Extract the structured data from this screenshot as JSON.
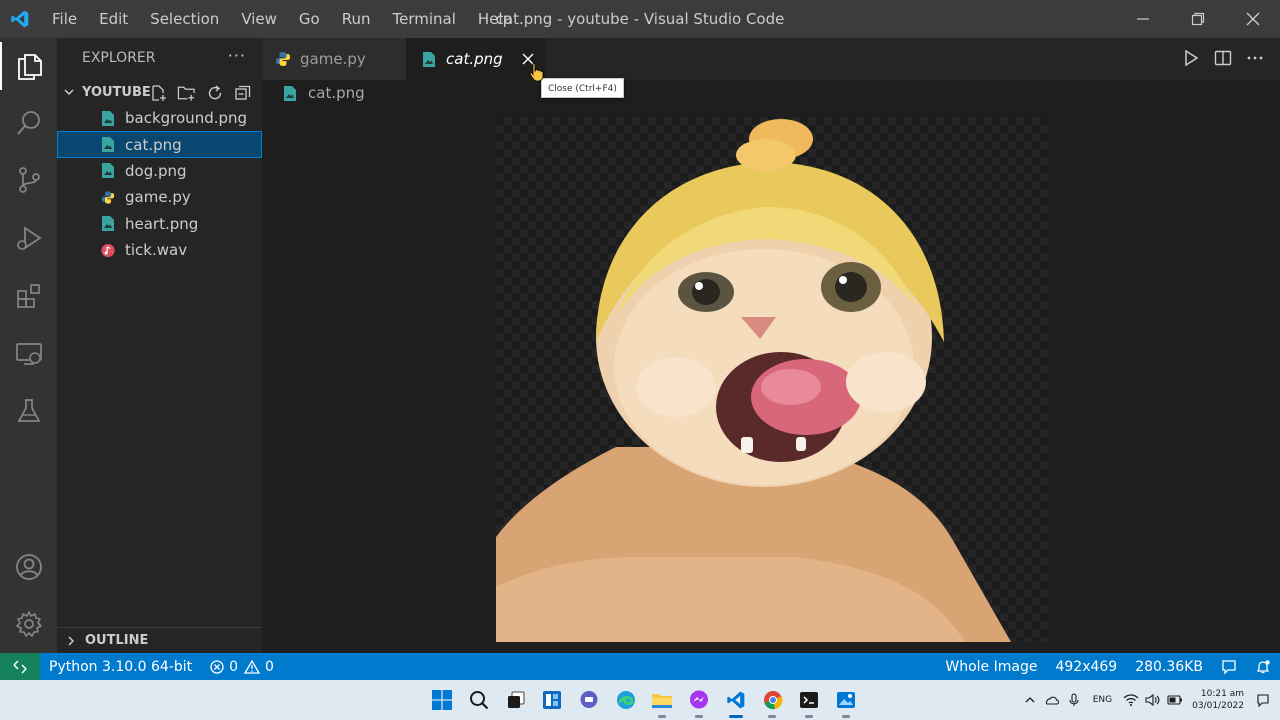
{
  "window": {
    "title": "cat.png - youtube - Visual Studio Code",
    "menu": [
      "File",
      "Edit",
      "Selection",
      "View",
      "Go",
      "Run",
      "Terminal",
      "Help"
    ]
  },
  "activity_bar": {
    "items": [
      "explorer-icon",
      "search-icon",
      "source-control-icon",
      "run-debug-icon",
      "extensions-icon",
      "remote-explorer-icon",
      "testing-icon"
    ],
    "bottom": [
      "accounts-icon",
      "settings-gear-icon"
    ]
  },
  "explorer": {
    "title": "EXPLORER",
    "more": "···",
    "folder": "YOUTUBE",
    "files": [
      {
        "name": "background.png",
        "type": "image"
      },
      {
        "name": "cat.png",
        "type": "image",
        "selected": true
      },
      {
        "name": "dog.png",
        "type": "image"
      },
      {
        "name": "game.py",
        "type": "python"
      },
      {
        "name": "heart.png",
        "type": "image"
      },
      {
        "name": "tick.wav",
        "type": "audio"
      }
    ],
    "outline": "OUTLINE"
  },
  "tabs": [
    {
      "label": "game.py",
      "active": false
    },
    {
      "label": "cat.png",
      "active": true
    }
  ],
  "tooltip": "Close (Ctrl+F4)",
  "breadcrumb": "cat.png",
  "status_bar": {
    "python": "Python 3.10.0 64-bit",
    "errors": "0",
    "warnings": "0",
    "zoom": "Whole Image",
    "dimensions": "492x469",
    "size": "280.36KB"
  },
  "taskbar": {
    "apps": [
      "windows-start-icon",
      "search-icon",
      "task-view-icon",
      "widgets-icon",
      "teams-chat-icon",
      "edge-icon",
      "file-explorer-icon",
      "messenger-icon",
      "vscode-icon",
      "chrome-icon",
      "terminal-icon",
      "photos-icon"
    ],
    "language": "ENG",
    "time": "10:21 am",
    "date": "03/01/2022"
  },
  "colors": {
    "accent": "#007acc",
    "remote": "#16825d",
    "selection": "#094771",
    "python_blue": "#3572a5",
    "python_yellow": "#ffd43b",
    "image_icon": "#3aa5a0",
    "audio_icon": "#e04f5f"
  }
}
